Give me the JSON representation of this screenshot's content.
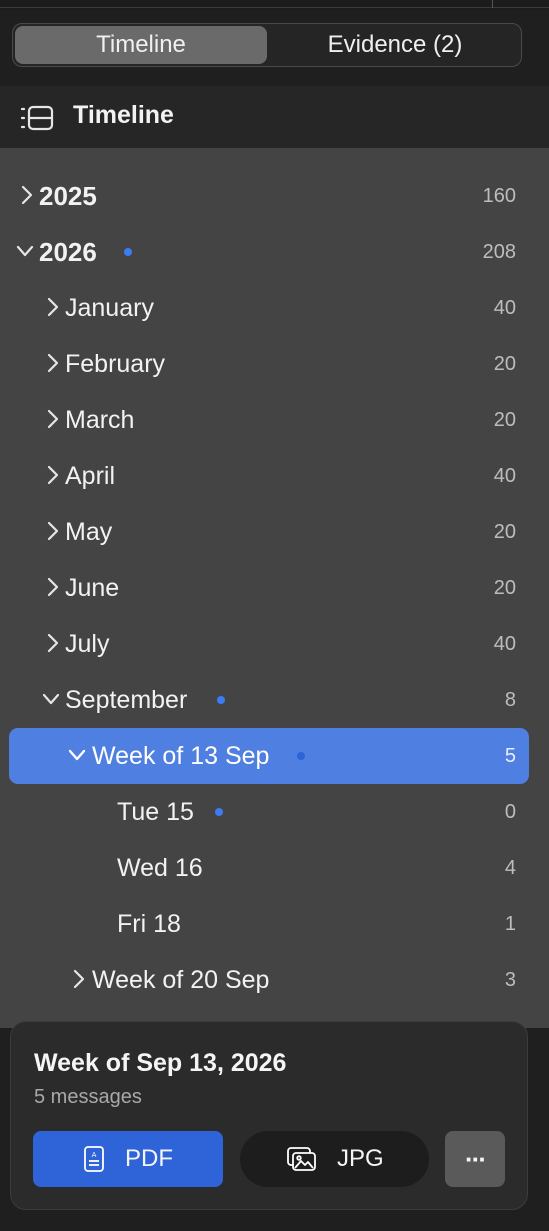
{
  "tabs": [
    {
      "label": "Timeline",
      "active": true
    },
    {
      "label": "Evidence (2)",
      "active": false
    }
  ],
  "header": {
    "title": "Timeline",
    "icon": "timeline-list-icon"
  },
  "tree": {
    "accent_color": "#3b7bf5",
    "selected_bg": "#4f7fe0",
    "rows": [
      {
        "label": "2025",
        "count": "160"
      },
      {
        "label": "2026",
        "count": "208"
      },
      {
        "label": "January",
        "count": "40"
      },
      {
        "label": "February",
        "count": "20"
      },
      {
        "label": "March",
        "count": "20"
      },
      {
        "label": "April",
        "count": "40"
      },
      {
        "label": "May",
        "count": "20"
      },
      {
        "label": "June",
        "count": "20"
      },
      {
        "label": "July",
        "count": "40"
      },
      {
        "label": "September",
        "count": "8"
      },
      {
        "label": "Week of 13 Sep",
        "count": "5"
      },
      {
        "label": "Tue 15",
        "count": "0"
      },
      {
        "label": "Wed 16",
        "count": "4"
      },
      {
        "label": "Fri 18",
        "count": "1"
      },
      {
        "label": "Week of 20 Sep",
        "count": "3"
      }
    ]
  },
  "details": {
    "title": "Week of Sep 13, 2026",
    "subtitle": "5 messages",
    "pdf_label": "PDF",
    "jpg_label": "JPG",
    "more_label": "···"
  }
}
